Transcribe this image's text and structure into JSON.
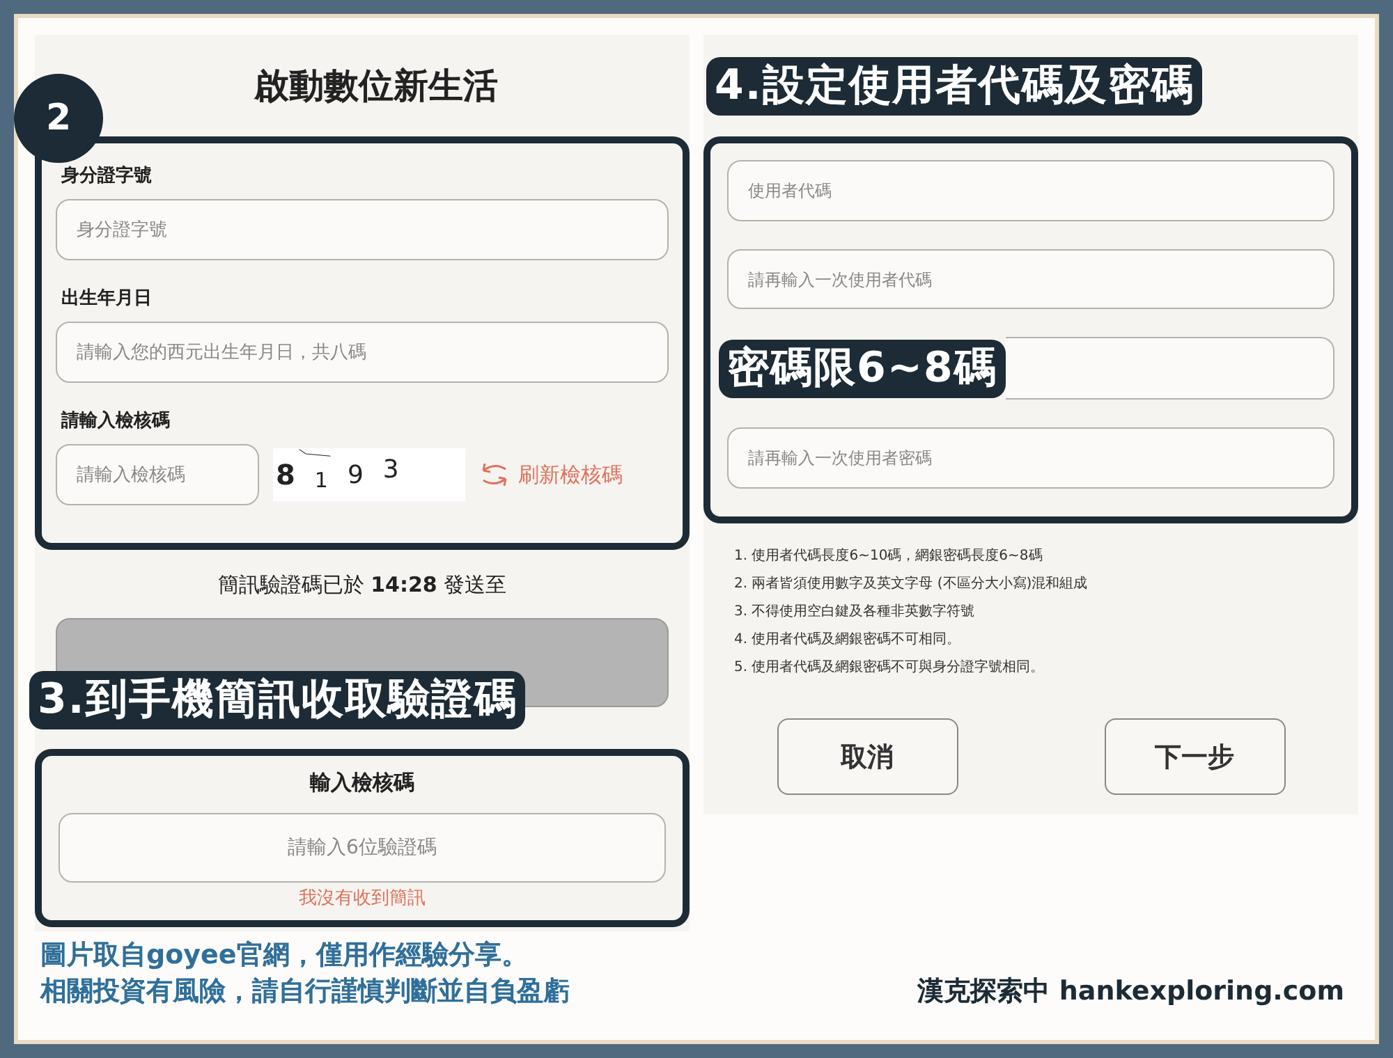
{
  "badge": "2",
  "left": {
    "title": "啟動數位新生活",
    "fields": [
      {
        "label": "身分證字號",
        "placeholder": "身分證字號"
      },
      {
        "label": "出生年月日",
        "placeholder": "請輸入您的西元出生年月日，共八碼"
      }
    ],
    "captcha": {
      "label": "請輸入檢核碼",
      "placeholder": "請輸入檢核碼",
      "digits": [
        "8",
        "1",
        "9",
        "3"
      ],
      "refresh": "刷新檢核碼"
    },
    "sms_notice": "簡訊驗證碼已於 **14:28** 發送至",
    "sms_callout": "3.到手機簡訊收取驗證碼",
    "code_box": {
      "title": "輸入檢核碼",
      "placeholder": "請輸入6位驗證碼",
      "link": "我沒有收到簡訊"
    }
  },
  "right": {
    "callout": "4.設定使用者代碼及密碼",
    "rows": [
      {
        "kind": "field",
        "placeholder": "使用者代碼"
      },
      {
        "kind": "field",
        "placeholder": "請再輸入一次使用者代碼"
      },
      {
        "kind": "covered_field",
        "callout": "密碼限6~8碼"
      },
      {
        "kind": "field",
        "placeholder": "請再輸入一次使用者密碼"
      }
    ],
    "rules": [
      "1. 使用者代碼長度6~10碼，網銀密碼長度6~8碼",
      "2. 兩者皆須使用數字及英文字母 (不區分大小寫)混和組成",
      "3. 不得使用空白鍵及各種非英數字符號",
      "4. 使用者代碼及網銀密碼不可相同。",
      "5. 使用者代碼及網銀密碼不可與身分證字號相同。"
    ],
    "buttons": [
      "取消",
      "下一步"
    ]
  },
  "caption": [
    "圖片取自goyee官網，僅用作經驗分享。",
    "相關投資有風險，請自行謹慎判斷並自負盈虧"
  ],
  "credit": "漢克探索中 hankexploring.com"
}
